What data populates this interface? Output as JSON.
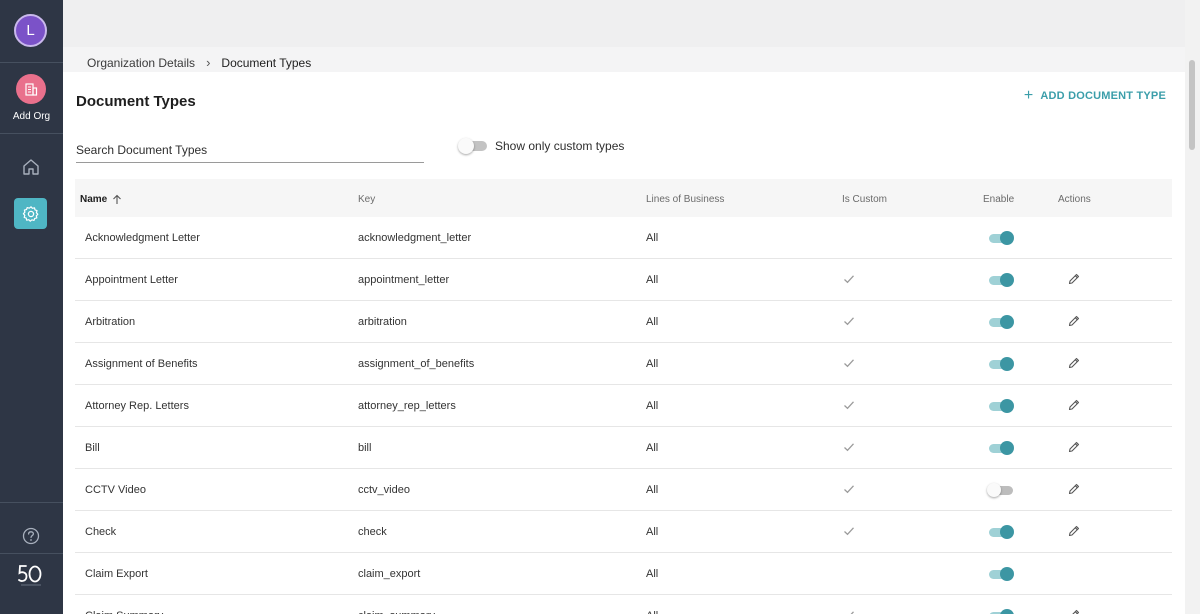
{
  "sidebar": {
    "avatar_initial": "L",
    "add_org_label": "Add Org",
    "icons": [
      "building-icon",
      "home-icon",
      "gear-icon",
      "help-icon",
      "logo"
    ],
    "accent_add_org": "#e9708c",
    "accent_settings": "#4fb6c4"
  },
  "breadcrumb": {
    "parent": "Organization Details",
    "current": "Document Types"
  },
  "page": {
    "title": "Document Types",
    "add_button_label": "ADD DOCUMENT TYPE",
    "search_placeholder": "Search Document Types",
    "filter_label": "Show only custom types",
    "filter_enabled": false
  },
  "table": {
    "columns": {
      "name": "Name",
      "key": "Key",
      "lob": "Lines of Business",
      "custom": "Is Custom",
      "enable": "Enable",
      "actions": "Actions"
    },
    "sort": {
      "column": "name",
      "direction": "ascending"
    },
    "rows": [
      {
        "name": "Acknowledgment Letter",
        "key": "acknowledgment_letter",
        "lob": "All",
        "is_custom": false,
        "enabled": true,
        "editable": false
      },
      {
        "name": "Appointment Letter",
        "key": "appointment_letter",
        "lob": "All",
        "is_custom": true,
        "enabled": true,
        "editable": true
      },
      {
        "name": "Arbitration",
        "key": "arbitration",
        "lob": "All",
        "is_custom": true,
        "enabled": true,
        "editable": true
      },
      {
        "name": "Assignment of Benefits",
        "key": "assignment_of_benefits",
        "lob": "All",
        "is_custom": true,
        "enabled": true,
        "editable": true
      },
      {
        "name": "Attorney Rep. Letters",
        "key": "attorney_rep_letters",
        "lob": "All",
        "is_custom": true,
        "enabled": true,
        "editable": true
      },
      {
        "name": "Bill",
        "key": "bill",
        "lob": "All",
        "is_custom": true,
        "enabled": true,
        "editable": true
      },
      {
        "name": "CCTV Video",
        "key": "cctv_video",
        "lob": "All",
        "is_custom": true,
        "enabled": false,
        "editable": true
      },
      {
        "name": "Check",
        "key": "check",
        "lob": "All",
        "is_custom": true,
        "enabled": true,
        "editable": true
      },
      {
        "name": "Claim Export",
        "key": "claim_export",
        "lob": "All",
        "is_custom": false,
        "enabled": true,
        "editable": false
      },
      {
        "name": "Claim Summary",
        "key": "claim_summary",
        "lob": "All",
        "is_custom": true,
        "enabled": true,
        "editable": true
      }
    ]
  },
  "colors": {
    "sidebar_bg": "#2e3645",
    "accent": "#3b9eaa",
    "toggle_on": "#3c96a3"
  }
}
